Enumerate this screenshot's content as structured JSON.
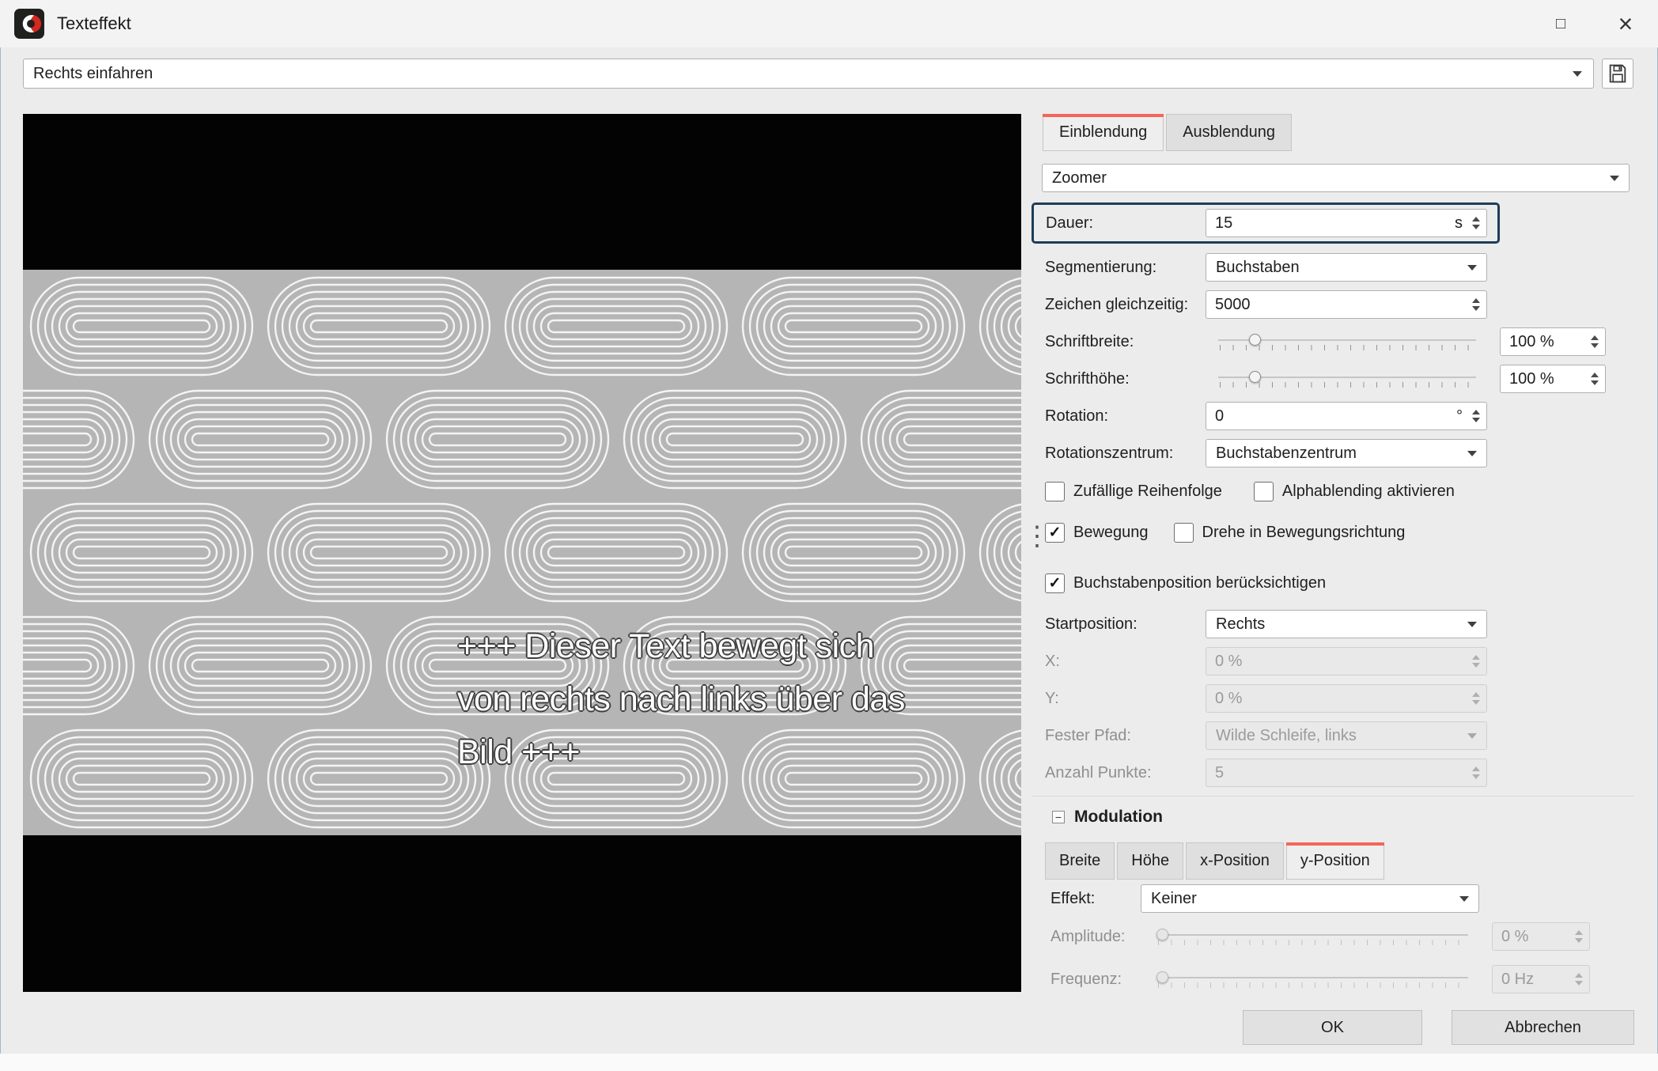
{
  "window": {
    "title": "Texteffekt"
  },
  "icons": {
    "maximize": "□",
    "close": "×",
    "check": "✓",
    "collapse": "−",
    "splitter": "⋮"
  },
  "toolbar": {
    "preset": "Rechts einfahren"
  },
  "preview": {
    "text_lines": [
      "+++ Dieser Text bewegt sich",
      "von rechts nach links über das",
      "Bild +++"
    ]
  },
  "panel": {
    "tab_einblendung": "Einblendung",
    "tab_ausblendung": "Ausblendung",
    "effect_type": "Zoomer",
    "dauer_label": "Dauer:",
    "dauer_value": "15",
    "dauer_unit": "s",
    "segmentierung_label": "Segmentierung:",
    "segmentierung_value": "Buchstaben",
    "zeichen_label": "Zeichen gleichzeitig:",
    "zeichen_value": "5000",
    "schriftbreite_label": "Schriftbreite:",
    "schriftbreite_value": "100 %",
    "schrifthoehe_label": "Schrifthöhe:",
    "schrifthoehe_value": "100 %",
    "rotation_label": "Rotation:",
    "rotation_value": "0",
    "rotation_unit": "°",
    "rotationszentrum_label": "Rotationszentrum:",
    "rotationszentrum_value": "Buchstabenzentrum",
    "startposition_label": "Startposition:",
    "startposition_value": "Rechts",
    "x_label": "X:",
    "x_value": "0 %",
    "y_label": "Y:",
    "y_value": "0 %",
    "fester_pfad_label": "Fester Pfad:",
    "fester_pfad_value": "Wilde Schleife, links",
    "anzahl_label": "Anzahl Punkte:",
    "anzahl_value": "5"
  },
  "checkboxes": {
    "zufaellig": {
      "label": "Zufällige Reihenfolge",
      "checked": false
    },
    "alpha": {
      "label": "Alphablending aktivieren",
      "checked": false
    },
    "bewegung": {
      "label": "Bewegung",
      "checked": true
    },
    "drehe": {
      "label": "Drehe in Bewegungsrichtung",
      "checked": false
    },
    "buchstabenpos": {
      "label": "Buchstabenposition berücksichtigen",
      "checked": true
    }
  },
  "modulation": {
    "title": "Modulation",
    "tab_breite": "Breite",
    "tab_hoehe": "Höhe",
    "tab_x": "x-Position",
    "tab_y": "y-Position",
    "effekt_label": "Effekt:",
    "effekt_value": "Keiner",
    "amplitude_label": "Amplitude:",
    "amplitude_value": "0 %",
    "frequenz_label": "Frequenz:",
    "frequenz_value": "0 Hz"
  },
  "footer": {
    "ok": "OK",
    "cancel": "Abbrechen"
  },
  "colors": {
    "accent_red": "#f4655a",
    "focus_border": "#1d3c59"
  }
}
